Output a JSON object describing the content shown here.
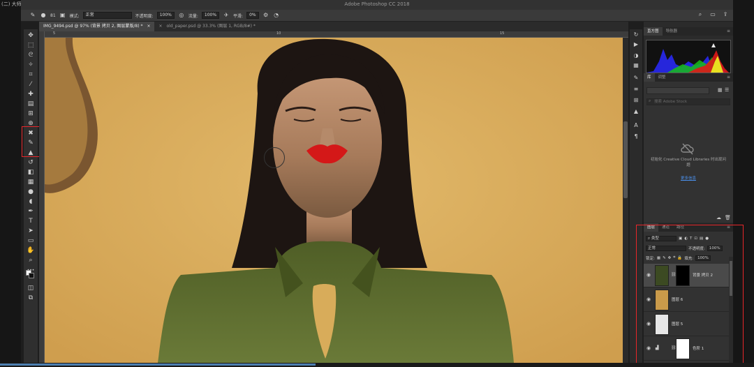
{
  "breadcrumb": "(二) 大师调色详解",
  "app_title": "Adobe Photoshop CC 2018",
  "options_bar": {
    "brush_size": "81",
    "mode_label": "模式:",
    "mode_value": "正常",
    "opacity_label": "不透明度:",
    "opacity_value": "100%",
    "flow_label": "流量:",
    "flow_value": "100%",
    "smoothing_label": "平滑:",
    "smoothing_value": "0%"
  },
  "tabs": [
    {
      "label": "IMG_9494.psd @ 97% (背景 拷贝 2, 图层蒙版/8) *",
      "active": true
    },
    {
      "label": "old_paper.psd @ 33.3% (图层 1, RGB/8#) *",
      "active": false
    }
  ],
  "ruler": {
    "marks": [
      "5",
      "10",
      "15"
    ]
  },
  "panels": {
    "top_tabs": [
      "直方图",
      "导航器"
    ],
    "lib_tabs": [
      "库",
      "调整"
    ],
    "lib_search_placeholder": "搜索 Adobe Stock",
    "lib_message": "初始化 Creative Cloud Libraries 时出现问题",
    "lib_link": "更多信息",
    "layers_tabs": [
      "图层",
      "通道",
      "路径"
    ],
    "layers_filter": "类型",
    "blend_mode": "正常",
    "opacity_label": "不透明度:",
    "opacity_value": "100%",
    "lock_label": "锁定:",
    "fill_label": "填充:",
    "fill_value": "100%",
    "layers": [
      {
        "name": "背景 拷贝 2",
        "selected": true
      },
      {
        "name": "图层 6",
        "selected": false
      },
      {
        "name": "图层 5",
        "selected": false
      },
      {
        "name": "色阶 1",
        "selected": false
      }
    ]
  },
  "colors": {
    "accent": "#4a8ee8",
    "highlight_box": "#e8262a",
    "wall": "#d8ac5a",
    "dress": "#5b6a2e",
    "lips": "#d41818"
  },
  "icons": {
    "workspace_search": "search-icon",
    "workspace_layout": "layout-icon",
    "share": "share-icon",
    "pressure": "pressure-icon"
  }
}
